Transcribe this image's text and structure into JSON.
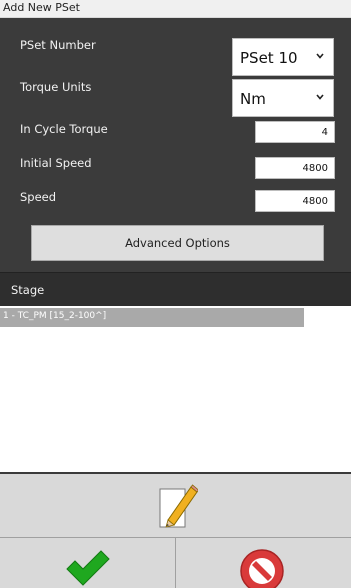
{
  "window": {
    "title": "Add New PSet"
  },
  "form": {
    "pset_number": {
      "label": "PSet Number",
      "value": "PSet 10"
    },
    "torque_units": {
      "label": "Torque Units",
      "value": "Nm"
    },
    "in_cycle_torque": {
      "label": "In Cycle Torque",
      "value": "4"
    },
    "initial_speed": {
      "label": "Initial Speed",
      "value": "4800"
    },
    "speed": {
      "label": "Speed",
      "value": "4800"
    },
    "advanced_button": "Advanced Options"
  },
  "stage": {
    "header": "Stage",
    "items": [
      "1 - TC_PM [15_2-100^]"
    ]
  },
  "actions": {
    "edit_icon": "pencil-icon",
    "ok_icon": "checkmark-icon",
    "cancel_icon": "no-entry-icon"
  },
  "colors": {
    "panel_bg": "#3b3b3b",
    "stage_header_bg": "#2e2e2e",
    "selected_row": "#a9a9a9",
    "ok_green": "#1fa81f",
    "cancel_red": "#d93a3a"
  }
}
